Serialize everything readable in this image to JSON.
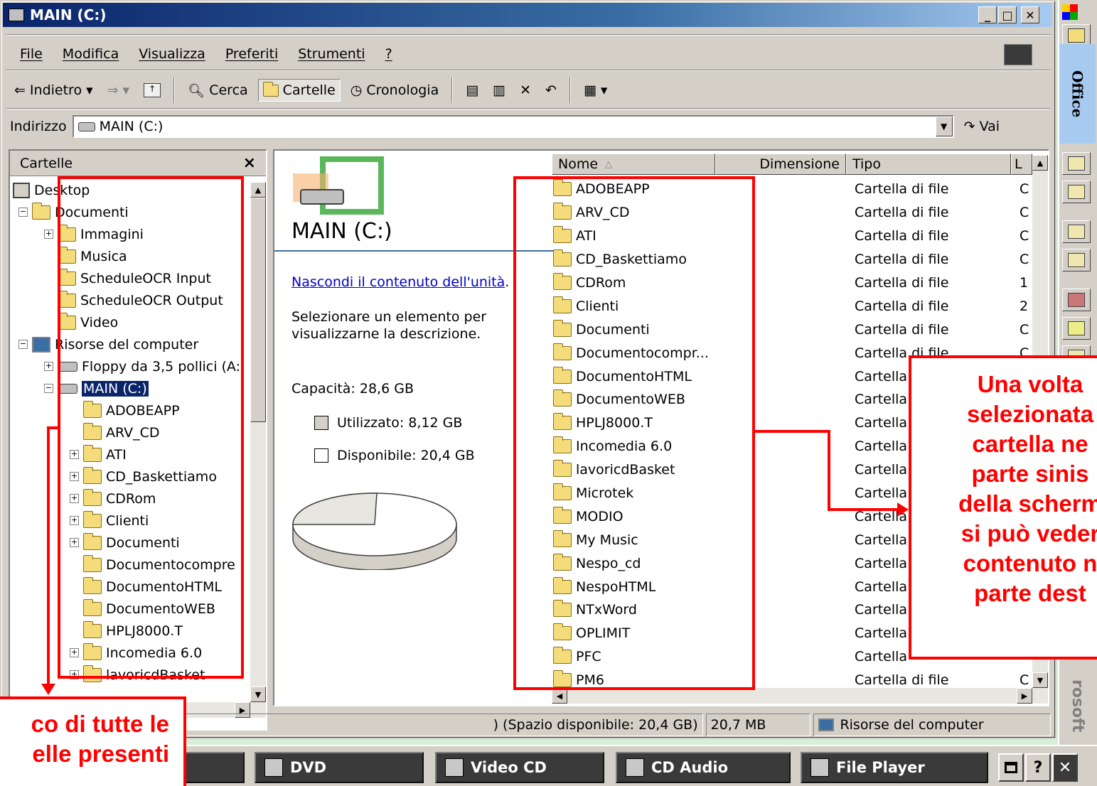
{
  "window": {
    "title": "MAIN (C:)"
  },
  "menu": [
    "File",
    "Modifica",
    "Visualizza",
    "Preferiti",
    "Strumenti",
    "?"
  ],
  "toolbar": {
    "back": "Indietro",
    "search": "Cerca",
    "folders": "Cartelle",
    "history": "Cronologia"
  },
  "address": {
    "label": "Indirizzo",
    "value": "MAIN (C:)",
    "go": "Vai"
  },
  "left_panel": {
    "title": "Cartelle",
    "close": "×",
    "tree": [
      "Desktop",
      "Documenti",
      "Immagini",
      "Musica",
      "ScheduleOCR Input",
      "ScheduleOCR Output",
      "Video",
      "Risorse del computer",
      "Floppy da 3,5 pollici (A:",
      "MAIN (C:)",
      "ADOBEAPP",
      "ARV_CD",
      "ATI",
      "CD_Baskettiamo",
      "CDRom",
      "Clienti",
      "Documenti",
      "Documentocompre",
      "DocumentoHTML",
      "DocumentoWEB",
      "HPLJ8000.T",
      "Incomedia 6.0",
      "lavoricdBasket"
    ]
  },
  "info": {
    "drive_title": "MAIN (C:)",
    "hide_link": "Nascondi il contenuto dell'unità",
    "hide_link_tail": ".",
    "select_hint": "Selezionare un elemento per visualizzarne la descrizione.",
    "capacity": "Capacità: 28,6 GB",
    "used": "Utilizzato: 8,12 GB",
    "free": "Disponibile: 20,4 GB"
  },
  "columns": {
    "name": "Nome",
    "size": "Dimensione",
    "type": "Tipo",
    "extra": "L"
  },
  "files": [
    "ADOBEAPP",
    "ARV_CD",
    "ATI",
    "CD_Baskettiamo",
    "CDRom",
    "Clienti",
    "Documenti",
    "Documentocompr...",
    "DocumentoHTML",
    "DocumentoWEB",
    "HPLJ8000.T",
    "Incomedia 6.0",
    "lavoricdBasket",
    "Microtek",
    "MODIO",
    "My Music",
    "Nespo_cd",
    "NespoHTML",
    "NTxWord",
    "OPLIMIT",
    "PFC",
    "PM6"
  ],
  "types": {
    "full": "Cartella di file",
    "short": "Cartella",
    "last_col": [
      "C",
      "C",
      "C",
      "C",
      "1",
      "2",
      "C",
      "C",
      "",
      "",
      "",
      "",
      "",
      "",
      "",
      "",
      "",
      "",
      "",
      "",
      "",
      "C"
    ]
  },
  "status": {
    "left": ") (Spazio disponibile: 20,4 GB)",
    "size": "20,7 MB",
    "zone": "Risorse del computer"
  },
  "taskbar": [
    "DVD",
    "Video CD",
    "CD Audio",
    "File Player"
  ],
  "taskbar_controls": [
    "?",
    "✕"
  ],
  "office_bar": {
    "label": "Office",
    "footer": "rosoft"
  },
  "callout_right": [
    "Una volta",
    "selezionata",
    "cartella ne",
    "parte sinis",
    "della scherm",
    "si può veder",
    "contenuto n",
    "parte dest"
  ],
  "callout_left": [
    "co di tutte le",
    "elle presenti"
  ],
  "colors": {
    "annotation": "#ff0000",
    "title_bar": "#0a246a",
    "link": "#0000cc"
  }
}
